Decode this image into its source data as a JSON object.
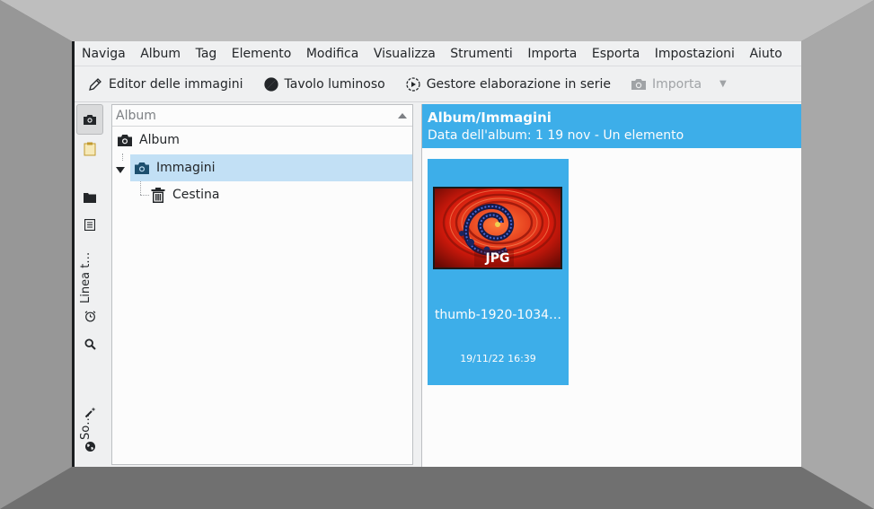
{
  "menubar": {
    "items": [
      "Naviga",
      "Album",
      "Tag",
      "Elemento",
      "Modifica",
      "Visualizza",
      "Strumenti",
      "Importa",
      "Esporta",
      "Impostazioni",
      "Aiuto"
    ]
  },
  "toolbar": {
    "image_editor": "Editor delle immagini",
    "light_table": "Tavolo luminoso",
    "batch_queue": "Gestore elaborazione in serie",
    "import": "Importa"
  },
  "sidebar": {
    "timeline_label": "Linea t…",
    "search_label": "So…"
  },
  "tree": {
    "header": "Album",
    "items": [
      "Album",
      "Immagini",
      "Cestina"
    ]
  },
  "content": {
    "title": "Album/Immagini",
    "subtitle": "Data dell'album: 1 19 nov - Un elemento"
  },
  "thumbnail": {
    "badge": "JPG",
    "name": "thumb-1920-1034…",
    "date": "19/11/22 16:39"
  },
  "colors": {
    "accent": "#3daee9",
    "selection": "#c2e0f5",
    "window_bg": "#eff0f1"
  }
}
